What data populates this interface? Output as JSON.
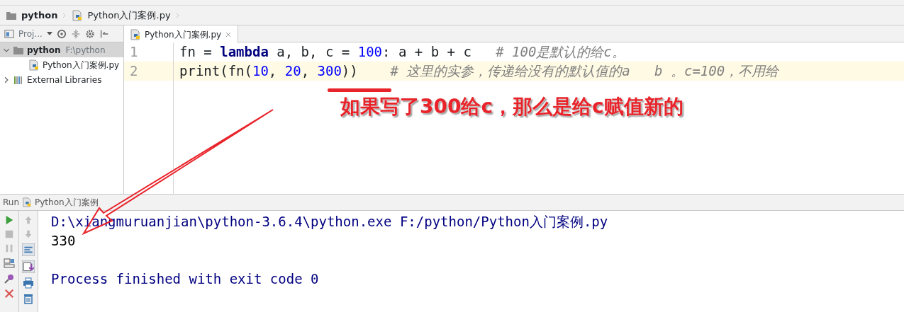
{
  "breadcrumb": [
    {
      "label": "python",
      "kind": "folder"
    },
    {
      "label": "Python入门案例.py",
      "kind": "file"
    }
  ],
  "project_panel": {
    "title": "Proj...",
    "tree": [
      {
        "label": "python",
        "hint": "F:\\python",
        "kind": "folder",
        "expanded": true,
        "selected": true,
        "children": [
          {
            "label": "Python入门案例.py",
            "kind": "file",
            "selected": false
          }
        ]
      },
      {
        "label": "External Libraries",
        "kind": "library",
        "expanded": false,
        "selected": false
      }
    ]
  },
  "editor": {
    "tabs": [
      {
        "label": "Python入门案例.py",
        "selected": true
      }
    ],
    "lines": [
      {
        "number": "1",
        "current": false,
        "tokens": [
          {
            "kind": "plain",
            "text": "fn = "
          },
          {
            "kind": "keyword",
            "text": "lambda"
          },
          {
            "kind": "plain",
            "text": " a, b, c = "
          },
          {
            "kind": "number",
            "text": "100"
          },
          {
            "kind": "plain",
            "text": ": a + b + c   "
          },
          {
            "kind": "comment",
            "text": "# 100是默认的给c。"
          }
        ]
      },
      {
        "number": "2",
        "current": true,
        "tokens": [
          {
            "kind": "plain",
            "text": "print(fn("
          },
          {
            "kind": "number",
            "text": "10"
          },
          {
            "kind": "plain",
            "text": ", "
          },
          {
            "kind": "number",
            "text": "20"
          },
          {
            "kind": "plain",
            "text": ", "
          },
          {
            "kind": "number",
            "text": "300"
          },
          {
            "kind": "plain",
            "text": "))    "
          },
          {
            "kind": "comment",
            "text": "# 这里的实参，传递给没有的默认值的a   b 。c=100，不用给"
          }
        ]
      }
    ]
  },
  "annotation": "如果写了300给c，那么是给c赋值新的",
  "run_panel": {
    "label": "Run",
    "config": "Python入门案例",
    "console": [
      {
        "kind": "command",
        "text": "D:\\xiangmuruanjian\\python-3.6.4\\python.exe F:/python/Python入门案例.py"
      },
      {
        "kind": "output",
        "text": "330"
      },
      {
        "kind": "blank"
      },
      {
        "kind": "system",
        "text": "Process finished with exit code 0"
      }
    ]
  }
}
